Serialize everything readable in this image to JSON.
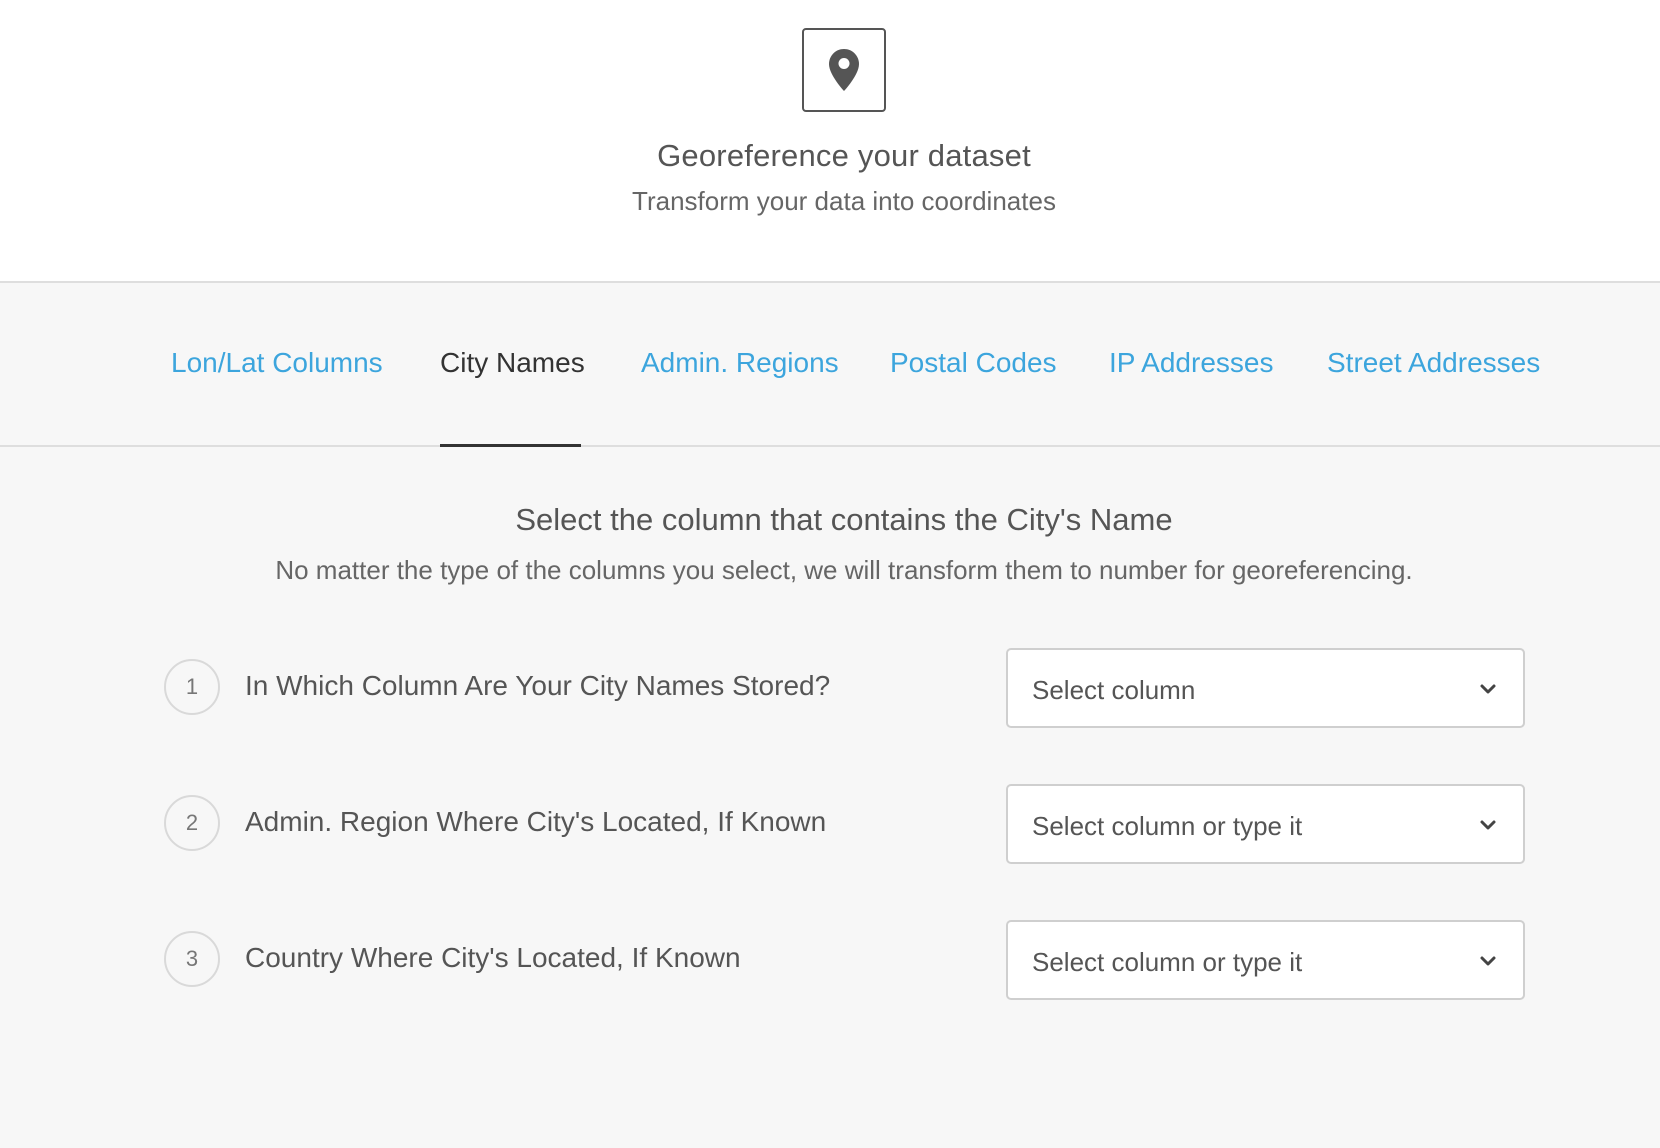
{
  "header": {
    "icon": "map-pin-icon",
    "title": "Georeference your dataset",
    "subtitle": "Transform your data into coordinates"
  },
  "tabs": [
    {
      "label": "Lon/Lat Columns",
      "active": false
    },
    {
      "label": "City Names",
      "active": true
    },
    {
      "label": "Admin. Regions",
      "active": false
    },
    {
      "label": "Postal Codes",
      "active": false
    },
    {
      "label": "IP Addresses",
      "active": false
    },
    {
      "label": "Street Addresses",
      "active": false
    }
  ],
  "section": {
    "title": "Select the column that contains the City's Name",
    "description": "No matter the type of the columns you select, we will transform them to number for georeferencing."
  },
  "steps": [
    {
      "number": "1",
      "label": "In Which Column Are Your City Names Stored?",
      "select_placeholder": "Select column"
    },
    {
      "number": "2",
      "label": "Admin. Region Where City's Located, If Known",
      "select_placeholder": "Select column or type it"
    },
    {
      "number": "3",
      "label": "Country Where City's Located, If Known",
      "select_placeholder": "Select column or type it"
    }
  ],
  "colors": {
    "link": "#3ca5dd",
    "active_tab": "#333333",
    "background": "#f7f7f7"
  }
}
